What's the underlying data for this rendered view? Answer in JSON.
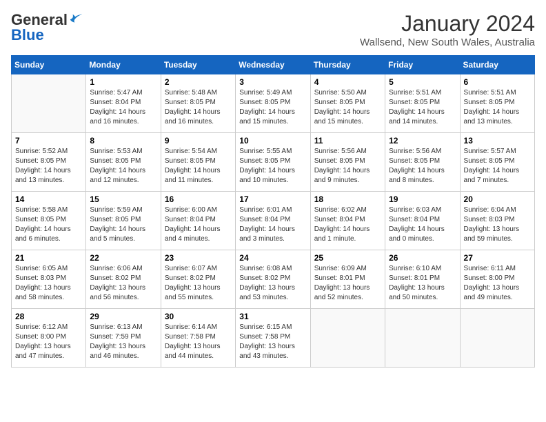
{
  "header": {
    "logo_general": "General",
    "logo_blue": "Blue",
    "month_title": "January 2024",
    "location": "Wallsend, New South Wales, Australia"
  },
  "days_of_week": [
    "Sunday",
    "Monday",
    "Tuesday",
    "Wednesday",
    "Thursday",
    "Friday",
    "Saturday"
  ],
  "weeks": [
    [
      {
        "day": "",
        "info": ""
      },
      {
        "day": "1",
        "info": "Sunrise: 5:47 AM\nSunset: 8:04 PM\nDaylight: 14 hours\nand 16 minutes."
      },
      {
        "day": "2",
        "info": "Sunrise: 5:48 AM\nSunset: 8:05 PM\nDaylight: 14 hours\nand 16 minutes."
      },
      {
        "day": "3",
        "info": "Sunrise: 5:49 AM\nSunset: 8:05 PM\nDaylight: 14 hours\nand 15 minutes."
      },
      {
        "day": "4",
        "info": "Sunrise: 5:50 AM\nSunset: 8:05 PM\nDaylight: 14 hours\nand 15 minutes."
      },
      {
        "day": "5",
        "info": "Sunrise: 5:51 AM\nSunset: 8:05 PM\nDaylight: 14 hours\nand 14 minutes."
      },
      {
        "day": "6",
        "info": "Sunrise: 5:51 AM\nSunset: 8:05 PM\nDaylight: 14 hours\nand 13 minutes."
      }
    ],
    [
      {
        "day": "7",
        "info": "Sunrise: 5:52 AM\nSunset: 8:05 PM\nDaylight: 14 hours\nand 13 minutes."
      },
      {
        "day": "8",
        "info": "Sunrise: 5:53 AM\nSunset: 8:05 PM\nDaylight: 14 hours\nand 12 minutes."
      },
      {
        "day": "9",
        "info": "Sunrise: 5:54 AM\nSunset: 8:05 PM\nDaylight: 14 hours\nand 11 minutes."
      },
      {
        "day": "10",
        "info": "Sunrise: 5:55 AM\nSunset: 8:05 PM\nDaylight: 14 hours\nand 10 minutes."
      },
      {
        "day": "11",
        "info": "Sunrise: 5:56 AM\nSunset: 8:05 PM\nDaylight: 14 hours\nand 9 minutes."
      },
      {
        "day": "12",
        "info": "Sunrise: 5:56 AM\nSunset: 8:05 PM\nDaylight: 14 hours\nand 8 minutes."
      },
      {
        "day": "13",
        "info": "Sunrise: 5:57 AM\nSunset: 8:05 PM\nDaylight: 14 hours\nand 7 minutes."
      }
    ],
    [
      {
        "day": "14",
        "info": "Sunrise: 5:58 AM\nSunset: 8:05 PM\nDaylight: 14 hours\nand 6 minutes."
      },
      {
        "day": "15",
        "info": "Sunrise: 5:59 AM\nSunset: 8:05 PM\nDaylight: 14 hours\nand 5 minutes."
      },
      {
        "day": "16",
        "info": "Sunrise: 6:00 AM\nSunset: 8:04 PM\nDaylight: 14 hours\nand 4 minutes."
      },
      {
        "day": "17",
        "info": "Sunrise: 6:01 AM\nSunset: 8:04 PM\nDaylight: 14 hours\nand 3 minutes."
      },
      {
        "day": "18",
        "info": "Sunrise: 6:02 AM\nSunset: 8:04 PM\nDaylight: 14 hours\nand 1 minute."
      },
      {
        "day": "19",
        "info": "Sunrise: 6:03 AM\nSunset: 8:04 PM\nDaylight: 14 hours\nand 0 minutes."
      },
      {
        "day": "20",
        "info": "Sunrise: 6:04 AM\nSunset: 8:03 PM\nDaylight: 13 hours\nand 59 minutes."
      }
    ],
    [
      {
        "day": "21",
        "info": "Sunrise: 6:05 AM\nSunset: 8:03 PM\nDaylight: 13 hours\nand 58 minutes."
      },
      {
        "day": "22",
        "info": "Sunrise: 6:06 AM\nSunset: 8:02 PM\nDaylight: 13 hours\nand 56 minutes."
      },
      {
        "day": "23",
        "info": "Sunrise: 6:07 AM\nSunset: 8:02 PM\nDaylight: 13 hours\nand 55 minutes."
      },
      {
        "day": "24",
        "info": "Sunrise: 6:08 AM\nSunset: 8:02 PM\nDaylight: 13 hours\nand 53 minutes."
      },
      {
        "day": "25",
        "info": "Sunrise: 6:09 AM\nSunset: 8:01 PM\nDaylight: 13 hours\nand 52 minutes."
      },
      {
        "day": "26",
        "info": "Sunrise: 6:10 AM\nSunset: 8:01 PM\nDaylight: 13 hours\nand 50 minutes."
      },
      {
        "day": "27",
        "info": "Sunrise: 6:11 AM\nSunset: 8:00 PM\nDaylight: 13 hours\nand 49 minutes."
      }
    ],
    [
      {
        "day": "28",
        "info": "Sunrise: 6:12 AM\nSunset: 8:00 PM\nDaylight: 13 hours\nand 47 minutes."
      },
      {
        "day": "29",
        "info": "Sunrise: 6:13 AM\nSunset: 7:59 PM\nDaylight: 13 hours\nand 46 minutes."
      },
      {
        "day": "30",
        "info": "Sunrise: 6:14 AM\nSunset: 7:58 PM\nDaylight: 13 hours\nand 44 minutes."
      },
      {
        "day": "31",
        "info": "Sunrise: 6:15 AM\nSunset: 7:58 PM\nDaylight: 13 hours\nand 43 minutes."
      },
      {
        "day": "",
        "info": ""
      },
      {
        "day": "",
        "info": ""
      },
      {
        "day": "",
        "info": ""
      }
    ]
  ]
}
